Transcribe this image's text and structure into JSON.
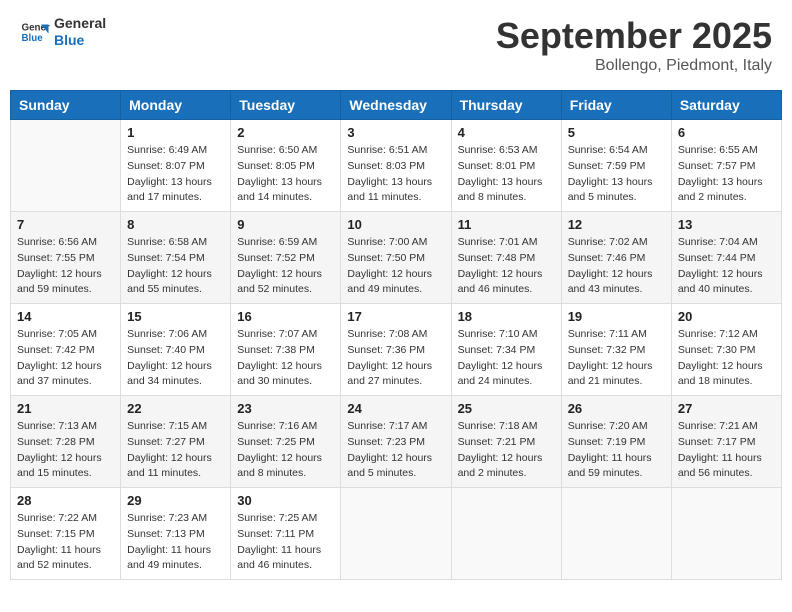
{
  "header": {
    "logo_line1": "General",
    "logo_line2": "Blue",
    "month_title": "September 2025",
    "subtitle": "Bollengo, Piedmont, Italy"
  },
  "days_of_week": [
    "Sunday",
    "Monday",
    "Tuesday",
    "Wednesday",
    "Thursday",
    "Friday",
    "Saturday"
  ],
  "weeks": [
    [
      {
        "day": "",
        "info": ""
      },
      {
        "day": "1",
        "info": "Sunrise: 6:49 AM\nSunset: 8:07 PM\nDaylight: 13 hours\nand 17 minutes."
      },
      {
        "day": "2",
        "info": "Sunrise: 6:50 AM\nSunset: 8:05 PM\nDaylight: 13 hours\nand 14 minutes."
      },
      {
        "day": "3",
        "info": "Sunrise: 6:51 AM\nSunset: 8:03 PM\nDaylight: 13 hours\nand 11 minutes."
      },
      {
        "day": "4",
        "info": "Sunrise: 6:53 AM\nSunset: 8:01 PM\nDaylight: 13 hours\nand 8 minutes."
      },
      {
        "day": "5",
        "info": "Sunrise: 6:54 AM\nSunset: 7:59 PM\nDaylight: 13 hours\nand 5 minutes."
      },
      {
        "day": "6",
        "info": "Sunrise: 6:55 AM\nSunset: 7:57 PM\nDaylight: 13 hours\nand 2 minutes."
      }
    ],
    [
      {
        "day": "7",
        "info": "Sunrise: 6:56 AM\nSunset: 7:55 PM\nDaylight: 12 hours\nand 59 minutes."
      },
      {
        "day": "8",
        "info": "Sunrise: 6:58 AM\nSunset: 7:54 PM\nDaylight: 12 hours\nand 55 minutes."
      },
      {
        "day": "9",
        "info": "Sunrise: 6:59 AM\nSunset: 7:52 PM\nDaylight: 12 hours\nand 52 minutes."
      },
      {
        "day": "10",
        "info": "Sunrise: 7:00 AM\nSunset: 7:50 PM\nDaylight: 12 hours\nand 49 minutes."
      },
      {
        "day": "11",
        "info": "Sunrise: 7:01 AM\nSunset: 7:48 PM\nDaylight: 12 hours\nand 46 minutes."
      },
      {
        "day": "12",
        "info": "Sunrise: 7:02 AM\nSunset: 7:46 PM\nDaylight: 12 hours\nand 43 minutes."
      },
      {
        "day": "13",
        "info": "Sunrise: 7:04 AM\nSunset: 7:44 PM\nDaylight: 12 hours\nand 40 minutes."
      }
    ],
    [
      {
        "day": "14",
        "info": "Sunrise: 7:05 AM\nSunset: 7:42 PM\nDaylight: 12 hours\nand 37 minutes."
      },
      {
        "day": "15",
        "info": "Sunrise: 7:06 AM\nSunset: 7:40 PM\nDaylight: 12 hours\nand 34 minutes."
      },
      {
        "day": "16",
        "info": "Sunrise: 7:07 AM\nSunset: 7:38 PM\nDaylight: 12 hours\nand 30 minutes."
      },
      {
        "day": "17",
        "info": "Sunrise: 7:08 AM\nSunset: 7:36 PM\nDaylight: 12 hours\nand 27 minutes."
      },
      {
        "day": "18",
        "info": "Sunrise: 7:10 AM\nSunset: 7:34 PM\nDaylight: 12 hours\nand 24 minutes."
      },
      {
        "day": "19",
        "info": "Sunrise: 7:11 AM\nSunset: 7:32 PM\nDaylight: 12 hours\nand 21 minutes."
      },
      {
        "day": "20",
        "info": "Sunrise: 7:12 AM\nSunset: 7:30 PM\nDaylight: 12 hours\nand 18 minutes."
      }
    ],
    [
      {
        "day": "21",
        "info": "Sunrise: 7:13 AM\nSunset: 7:28 PM\nDaylight: 12 hours\nand 15 minutes."
      },
      {
        "day": "22",
        "info": "Sunrise: 7:15 AM\nSunset: 7:27 PM\nDaylight: 12 hours\nand 11 minutes."
      },
      {
        "day": "23",
        "info": "Sunrise: 7:16 AM\nSunset: 7:25 PM\nDaylight: 12 hours\nand 8 minutes."
      },
      {
        "day": "24",
        "info": "Sunrise: 7:17 AM\nSunset: 7:23 PM\nDaylight: 12 hours\nand 5 minutes."
      },
      {
        "day": "25",
        "info": "Sunrise: 7:18 AM\nSunset: 7:21 PM\nDaylight: 12 hours\nand 2 minutes."
      },
      {
        "day": "26",
        "info": "Sunrise: 7:20 AM\nSunset: 7:19 PM\nDaylight: 11 hours\nand 59 minutes."
      },
      {
        "day": "27",
        "info": "Sunrise: 7:21 AM\nSunset: 7:17 PM\nDaylight: 11 hours\nand 56 minutes."
      }
    ],
    [
      {
        "day": "28",
        "info": "Sunrise: 7:22 AM\nSunset: 7:15 PM\nDaylight: 11 hours\nand 52 minutes."
      },
      {
        "day": "29",
        "info": "Sunrise: 7:23 AM\nSunset: 7:13 PM\nDaylight: 11 hours\nand 49 minutes."
      },
      {
        "day": "30",
        "info": "Sunrise: 7:25 AM\nSunset: 7:11 PM\nDaylight: 11 hours\nand 46 minutes."
      },
      {
        "day": "",
        "info": ""
      },
      {
        "day": "",
        "info": ""
      },
      {
        "day": "",
        "info": ""
      },
      {
        "day": "",
        "info": ""
      }
    ]
  ]
}
